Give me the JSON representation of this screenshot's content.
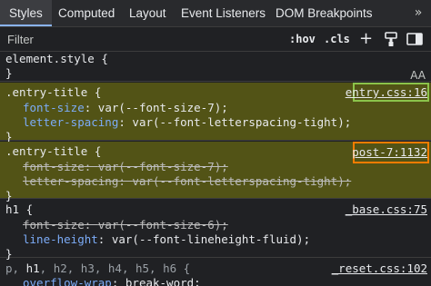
{
  "tabs": [
    {
      "label": "Styles",
      "active": true
    },
    {
      "label": "Computed",
      "active": false
    },
    {
      "label": "Layout",
      "active": false
    },
    {
      "label": "Event Listeners",
      "active": false
    },
    {
      "label": "DOM Breakpoints",
      "active": false
    }
  ],
  "tabs_overflow": "»",
  "filter": {
    "placeholder": "Filter",
    "value": ""
  },
  "filter_buttons": {
    "hov": ":hov",
    "cls": ".cls",
    "add": "+"
  },
  "icons": [
    "new-style-rule-icon",
    "paint-brush-icon",
    "sidebar-toggle-icon",
    "font-size-icon"
  ],
  "element_style": {
    "selector": "element.style {",
    "close": "}",
    "aa_icon": "AA"
  },
  "rules": [
    {
      "selector": ".entry-title {",
      "source": "entry.css:16",
      "highlighted": true,
      "source_box": "green",
      "props": [
        {
          "name": "font-size",
          "value": "var(--font-size-7);",
          "struck": false
        },
        {
          "name": "letter-spacing",
          "value": "var(--font-letterspacing-tight);",
          "struck": false
        }
      ],
      "close": "}"
    },
    {
      "selector": ".entry-title {",
      "source": "post-7:1132",
      "highlighted": true,
      "source_box": "orange",
      "props": [
        {
          "name": "font-size",
          "value": "var(--font-size-7);",
          "struck": true
        },
        {
          "name": "letter-spacing",
          "value": "var(--font-letterspacing-tight);",
          "struck": true
        }
      ],
      "close": "}"
    },
    {
      "selector": "h1 {",
      "source": "_base.css:75",
      "highlighted": false,
      "props": [
        {
          "name": "font-size",
          "value": "var(--font-size-6);",
          "struck": true
        },
        {
          "name": "line-height",
          "value": "var(--font-lineheight-fluid);",
          "struck": false
        }
      ],
      "close": "}"
    },
    {
      "selector_parts": [
        "p, ",
        "h1",
        ", h2, h3, h4, h5, h6 {"
      ],
      "source": "_reset.css:102",
      "highlighted": false,
      "props": [
        {
          "name": "overflow-wrap",
          "value": "break-word;",
          "struck": false
        }
      ]
    }
  ],
  "colors": {
    "background": "#202124",
    "highlight": "#525316",
    "property": "#7cacf8",
    "green_box": "#8bc34a",
    "orange_box": "#f57c00",
    "tab_underline": "#8ab4f8"
  }
}
